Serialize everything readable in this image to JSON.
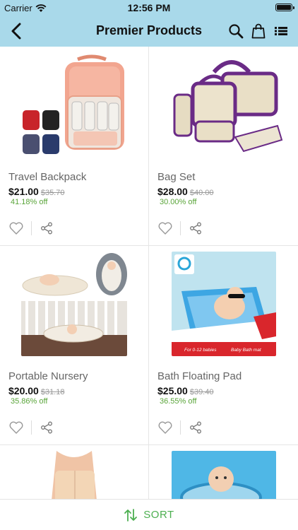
{
  "status_bar": {
    "carrier": "Carrier",
    "time": "12:56 PM"
  },
  "header": {
    "title": "Premier Products"
  },
  "icons": {
    "back": "chevron-left-icon",
    "search": "search-icon",
    "cart": "shopping-bag-icon",
    "menu": "list-menu-icon",
    "favorite": "heart-icon",
    "share": "share-icon",
    "sort": "sort-arrows-icon"
  },
  "products": [
    {
      "name": "Travel Backpack",
      "price": "$21.00",
      "old_price": "$35.70",
      "discount": "41.18% off"
    },
    {
      "name": "Bag Set",
      "price": "$28.00",
      "old_price": "$40.00",
      "discount": "30.00% off"
    },
    {
      "name": "Portable Nursery",
      "price": "$20.00",
      "old_price": "$31.18",
      "discount": "35.86% off"
    },
    {
      "name": "Bath Floating Pad",
      "price": "$25.00",
      "old_price": "$39.40",
      "discount": "36.55% off",
      "image_text": {
        "badge": "",
        "caption_left": "For 0-12 babies",
        "caption_right": "Baby Bath mat"
      }
    },
    {
      "name": "",
      "price": "",
      "old_price": "",
      "discount": ""
    },
    {
      "name": "",
      "price": "",
      "old_price": "",
      "discount": ""
    }
  ],
  "sort": {
    "label": "SORT"
  },
  "colors": {
    "header_bg": "#a9d9ea",
    "discount": "#5aa53a",
    "sort_accent": "#4caf50"
  }
}
